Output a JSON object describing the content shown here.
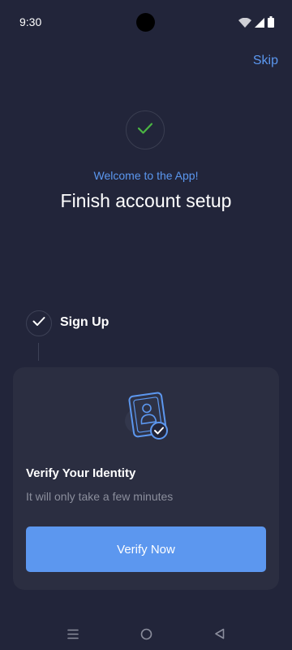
{
  "status_bar": {
    "time": "9:30",
    "icons": [
      "wifi-icon",
      "signal-icon",
      "battery-icon"
    ]
  },
  "header": {
    "skip_label": "Skip"
  },
  "hero": {
    "icon": "check-icon",
    "welcome_text": "Welcome to the App!",
    "title": "Finish account setup"
  },
  "steps": [
    {
      "label": "Sign Up",
      "completed": true
    }
  ],
  "card": {
    "illustration": "id-card-verified-icon",
    "title": "Verify Your Identity",
    "subtitle": "It will only take a few minutes",
    "button_label": "Verify Now"
  },
  "nav_bar": {
    "icons": [
      "menu-icon",
      "home-icon",
      "back-icon"
    ]
  },
  "colors": {
    "background": "#22253a",
    "card": "#2b2e41",
    "accent": "#5c97ef",
    "success": "#4bb543",
    "muted_text": "#8b8e9c"
  }
}
